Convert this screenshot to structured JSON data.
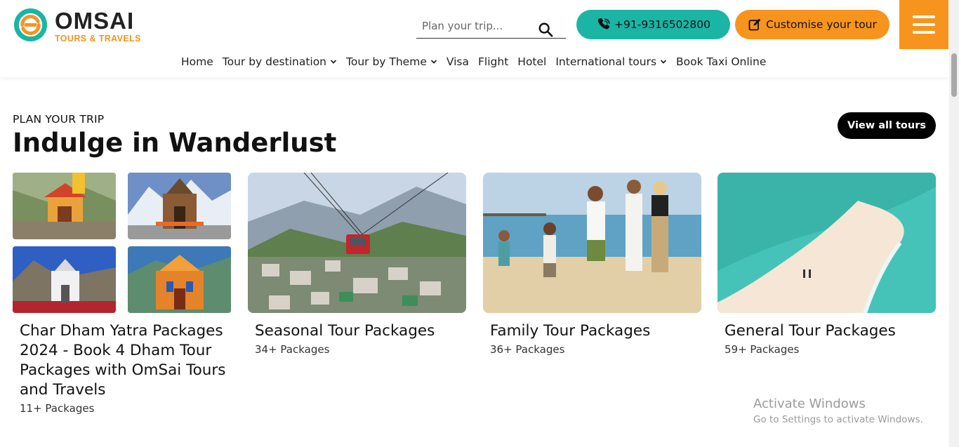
{
  "brand": {
    "name": "OMSAI",
    "tagline": "TOURS & TRAVELS",
    "colors": {
      "teal": "#1ab5a5",
      "orange": "#f7941d",
      "dark": "#222222"
    }
  },
  "header": {
    "search_placeholder": "Plan your trip...",
    "search_icon": "search-icon",
    "phone_label": "+91-9316502800",
    "phone_icon": "phone-icon",
    "customise_label": "Customise your tour",
    "customise_icon": "edit-icon",
    "menu_icon": "hamburger-icon"
  },
  "nav": {
    "items": [
      {
        "label": "Home",
        "dropdown": false
      },
      {
        "label": "Tour by destination",
        "dropdown": true
      },
      {
        "label": "Tour by Theme",
        "dropdown": true
      },
      {
        "label": "Visa",
        "dropdown": false
      },
      {
        "label": "Flight",
        "dropdown": false
      },
      {
        "label": "Hotel",
        "dropdown": false
      },
      {
        "label": "International tours",
        "dropdown": true
      },
      {
        "label": "Book Taxi Online",
        "dropdown": false
      }
    ]
  },
  "main": {
    "kicker": "PLAN YOUR TRIP",
    "title": "Indulge in Wanderlust",
    "view_all_label": "View all tours",
    "cards": [
      {
        "title": "Char Dham Yatra Packages 2024 - Book 4 Dham Tour Packages with OmSai Tours and Travels",
        "count": "11+ Packages"
      },
      {
        "title": "Seasonal Tour Packages",
        "count": "34+ Packages"
      },
      {
        "title": "Family Tour Packages",
        "count": "36+ Packages"
      },
      {
        "title": "General Tour Packages",
        "count": "59+ Packages"
      }
    ]
  },
  "watermark": {
    "line1": "Activate Windows",
    "line2": "Go to Settings to activate Windows."
  }
}
